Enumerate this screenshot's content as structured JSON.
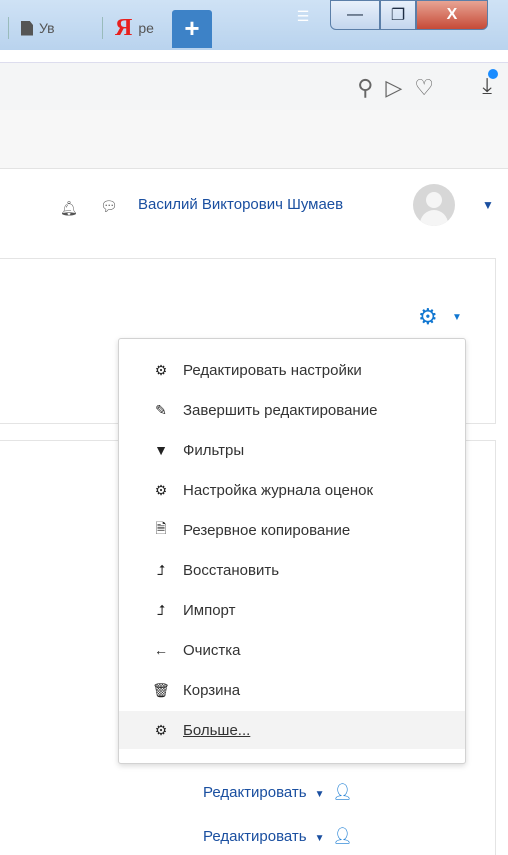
{
  "browser": {
    "tabs": [
      {
        "label": "Ув"
      },
      {
        "label": "ре",
        "logo": "Я"
      }
    ],
    "new_tab_label": "+",
    "window_controls": {
      "minimize": "—",
      "maximize": "❐",
      "close": "X"
    },
    "address_icons": [
      "zoom-icon",
      "send-icon",
      "heart-icon"
    ],
    "download_icon": "download-icon"
  },
  "header": {
    "user_name": "Василий Викторович Шумаев"
  },
  "settings_menu": {
    "items": [
      {
        "label": "Редактировать настройки",
        "icon": "gear-icon"
      },
      {
        "label": "Завершить редактирование",
        "icon": "pencil-icon"
      },
      {
        "label": "Фильтры",
        "icon": "filter-icon"
      },
      {
        "label": "Настройка журнала оценок",
        "icon": "gear-icon"
      },
      {
        "label": "Резервное копирование",
        "icon": "file-download-icon"
      },
      {
        "label": "Восстановить",
        "icon": "upload-arrow-icon"
      },
      {
        "label": "Импорт",
        "icon": "upload-arrow-icon"
      },
      {
        "label": "Очистка",
        "icon": "arrow-left-icon"
      },
      {
        "label": "Корзина",
        "icon": "trash-icon"
      },
      {
        "label": "Больше...",
        "icon": "gear-icon"
      }
    ]
  },
  "edit_links": [
    {
      "label": "Редактировать"
    },
    {
      "label": "Редактировать"
    }
  ],
  "colors": {
    "accent": "#1177d1",
    "link": "#1a4fa0",
    "yandex_red": "#e8201e"
  }
}
